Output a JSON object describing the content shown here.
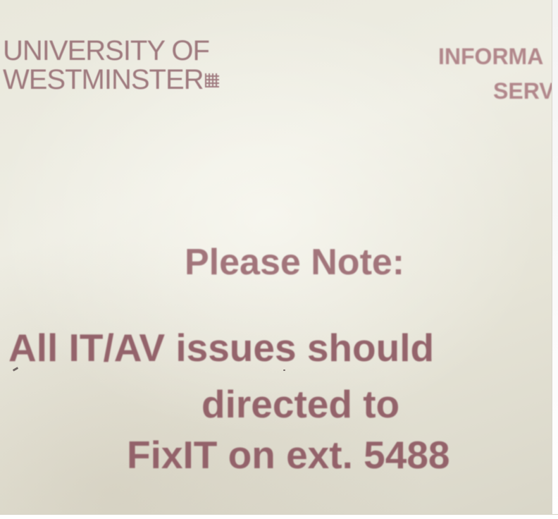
{
  "logo": {
    "line1": "UNIVERSITY OF",
    "line2": "WESTMINSTER"
  },
  "department": {
    "line1": "INFORMA",
    "line2": "SERV"
  },
  "notice": {
    "heading": "Please Note:",
    "line1": "All IT/AV issues should",
    "line2": "directed to",
    "line3": "FixIT on ext. 5488"
  },
  "colors": {
    "paper": "#eceade",
    "ink": "#8c5660",
    "logo_ink": "#8e6169"
  }
}
